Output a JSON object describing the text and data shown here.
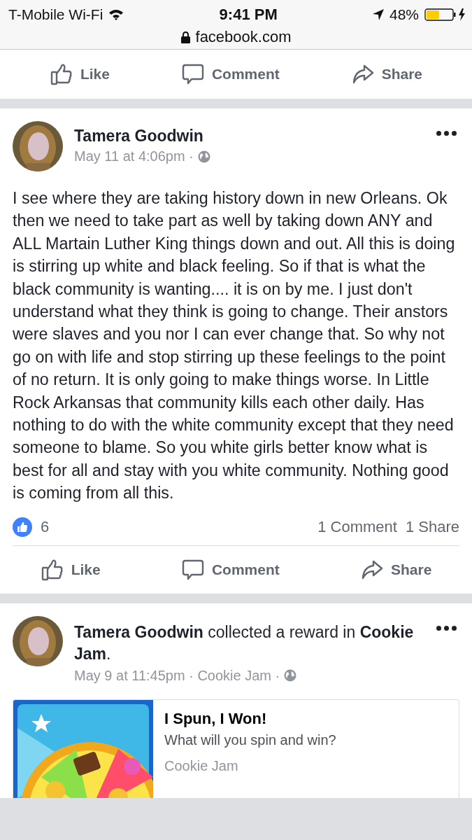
{
  "status_bar": {
    "carrier": "T-Mobile Wi-Fi",
    "time": "9:41 PM",
    "battery": "48%",
    "url": "facebook.com"
  },
  "top_actions": [
    {
      "kind": "like",
      "label": "Like"
    },
    {
      "kind": "comment",
      "label": "Comment"
    },
    {
      "kind": "share",
      "label": "Share"
    }
  ],
  "posts": [
    {
      "kind": "status",
      "author": "Tamera Goodwin",
      "meta": "May 11 at 4:06pm ·",
      "text": "I see where they are taking history down in new Orleans. Ok then we need to take part as well by taking down ANY and ALL Martain Luther King things down and out. All this is doing is stirring up white and black feeling. So if that is what the black community is wanting.... it is on by me. I just don't understand what they think is going to change. Their anstors were slaves and you nor I can ever change that. So why not go on with life and stop stirring up these feelings to the point of no return. It is only going to make things worse. In Little Rock Arkansas that community kills each other daily. Has nothing to do with the white community except that they need someone to blame. So you white girls better know what is best for all and stay with you white community. Nothing good is coming from all this.",
      "likes": "6",
      "comments": "1 Comment",
      "shares": "1 Share",
      "actions": [
        {
          "kind": "like",
          "label": "Like"
        },
        {
          "kind": "comment",
          "label": "Comment"
        },
        {
          "kind": "share",
          "label": "Share"
        }
      ]
    },
    {
      "kind": "game",
      "headline": "**Tamera Goodwin** collected a reward in **Cookie Jam**.",
      "meta": "May 9 at 11:45pm · Cookie Jam ·",
      "card": {
        "title": "I Spun, I Won!",
        "description": "What will you spin and win?",
        "source": "Cookie Jam"
      }
    }
  ]
}
